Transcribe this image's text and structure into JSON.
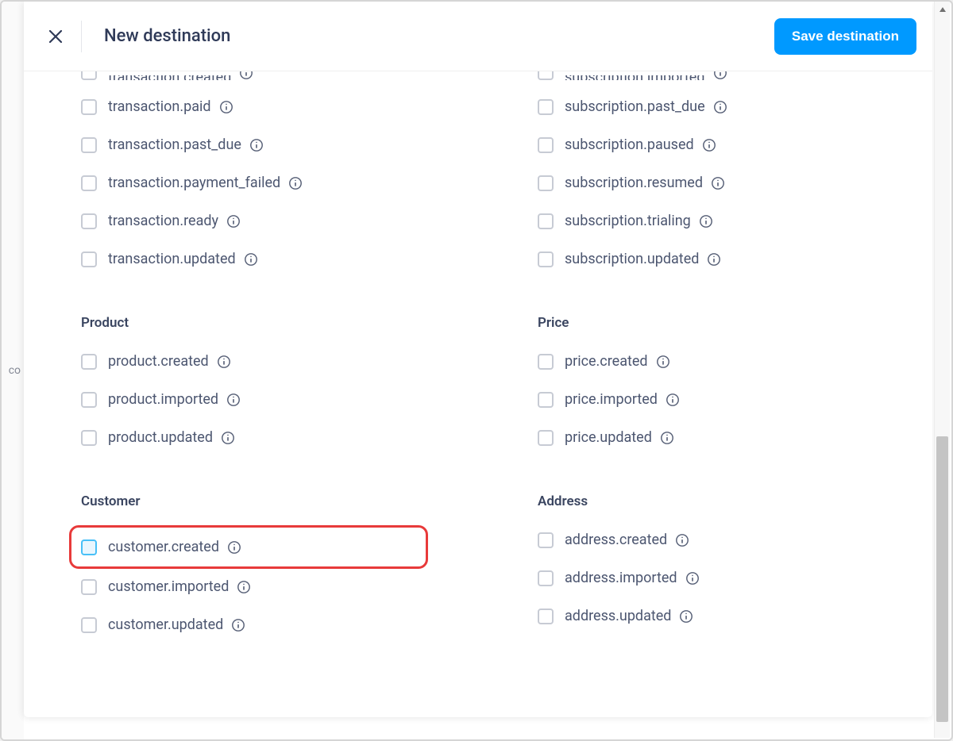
{
  "header": {
    "title": "New destination",
    "save_label": "Save destination"
  },
  "left_column": {
    "partial_top": "transaction.created",
    "groups": [
      {
        "title": "",
        "events": [
          {
            "label": "transaction.paid",
            "highlighted": false
          },
          {
            "label": "transaction.past_due",
            "highlighted": false
          },
          {
            "label": "transaction.payment_failed",
            "highlighted": false
          },
          {
            "label": "transaction.ready",
            "highlighted": false
          },
          {
            "label": "transaction.updated",
            "highlighted": false
          }
        ]
      },
      {
        "title": "Product",
        "events": [
          {
            "label": "product.created",
            "highlighted": false
          },
          {
            "label": "product.imported",
            "highlighted": false
          },
          {
            "label": "product.updated",
            "highlighted": false
          }
        ]
      },
      {
        "title": "Customer",
        "events": [
          {
            "label": "customer.created",
            "highlighted": true
          },
          {
            "label": "customer.imported",
            "highlighted": false
          },
          {
            "label": "customer.updated",
            "highlighted": false
          }
        ]
      }
    ]
  },
  "right_column": {
    "partial_top": "subscription.imported",
    "groups": [
      {
        "title": "",
        "events": [
          {
            "label": "subscription.past_due",
            "highlighted": false
          },
          {
            "label": "subscription.paused",
            "highlighted": false
          },
          {
            "label": "subscription.resumed",
            "highlighted": false
          },
          {
            "label": "subscription.trialing",
            "highlighted": false
          },
          {
            "label": "subscription.updated",
            "highlighted": false
          }
        ]
      },
      {
        "title": "Price",
        "events": [
          {
            "label": "price.created",
            "highlighted": false
          },
          {
            "label": "price.imported",
            "highlighted": false
          },
          {
            "label": "price.updated",
            "highlighted": false
          }
        ]
      },
      {
        "title": "Address",
        "events": [
          {
            "label": "address.created",
            "highlighted": false
          },
          {
            "label": "address.imported",
            "highlighted": false
          },
          {
            "label": "address.updated",
            "highlighted": false
          }
        ]
      }
    ]
  },
  "bg_text": "co"
}
